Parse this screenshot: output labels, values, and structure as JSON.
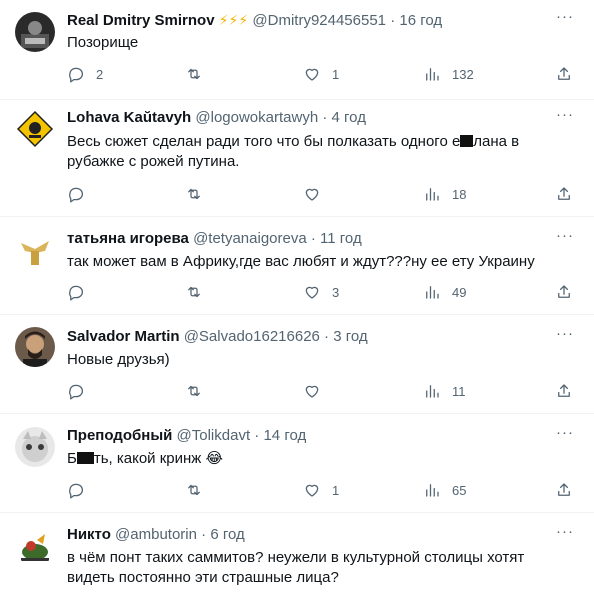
{
  "tweets": [
    {
      "name": "Real Dmitry Smirnov",
      "emojis": "⚡⚡⚡",
      "handle": "@Dmitry924456551",
      "time": "16 год",
      "text": "Позорище",
      "replies": "2",
      "retweets": "",
      "likes": "1",
      "views": "132"
    },
    {
      "name": "Lohava Kaŭtavyh",
      "handle": "@logowokartawyh",
      "time": "4 год",
      "text_a": "Весь сюжет сделан ради того что бы полказать одного е",
      "text_b": "лана в рубажке с рожей путина.",
      "replies": "",
      "retweets": "",
      "likes": "",
      "views": "18"
    },
    {
      "name": "татьяна игорева",
      "handle": "@tetyanaigoreva",
      "time": "11 год",
      "text": "так может вам в Африку,где вас любят и ждут???ну ее ету Украину",
      "replies": "",
      "retweets": "",
      "likes": "3",
      "views": "49"
    },
    {
      "name": "Salvador Martin",
      "handle": "@Salvado16216626",
      "time": "3 год",
      "text": "Новые друзья)",
      "replies": "",
      "retweets": "",
      "likes": "",
      "views": "11"
    },
    {
      "name": "Преподобный",
      "handle": "@Tolikdavt",
      "time": "14 год",
      "text_a": "Б",
      "text_b": "ть, какой кринж 😂",
      "replies": "",
      "retweets": "",
      "likes": "1",
      "views": "65"
    },
    {
      "name": "Никто",
      "handle": "@ambutorin",
      "time": "6 год",
      "text": "в чём понт таких саммитов? неужели в культурной столицы хотят видеть постоянно эти страшные лица?"
    }
  ],
  "separator": "·",
  "more_glyph": "···",
  "colors": {
    "text": "#0f1419",
    "secondary": "#536471",
    "border": "#eff3f4"
  }
}
